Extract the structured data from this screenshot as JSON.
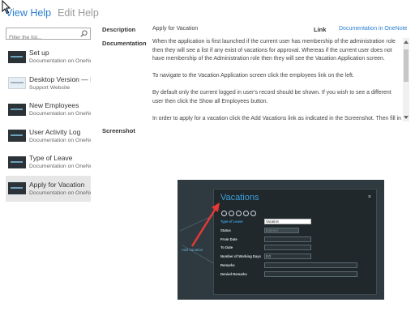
{
  "tabs": {
    "view_help": "View Help",
    "edit_help": "Edit Help"
  },
  "search": {
    "placeholder": "Filter the list..."
  },
  "list": {
    "items": [
      {
        "title": "Set up",
        "subtitle": "Documentation on OneNote"
      },
      {
        "title": "Desktop Version — Page",
        "subtitle": "Support Website"
      },
      {
        "title": "New Employees",
        "subtitle": "Documentation on OneNote"
      },
      {
        "title": "User Activity Log",
        "subtitle": "Documentation on OneNote"
      },
      {
        "title": "Type of Leave",
        "subtitle": "Documentation on OneNote"
      },
      {
        "title": "Apply for Vacation",
        "subtitle": "Documentation on OneNote"
      }
    ],
    "selected_index": 5
  },
  "detail": {
    "description_label": "Description",
    "description_value": "Apply for Vacation",
    "link_label": "Link",
    "link_value": "Documentation in OneNote",
    "documentation_label": "Documentation",
    "documentation_paragraphs": [
      "When the application is first launched if the current user has membership of the administration role then they will see a list if any exist of vacations for approval.  Whereas if the current user does not have membership of the Administration role then they will see the Vacation Application screen.",
      "To navigate to the Vacation Application screen click the employees link on the left.",
      "By default only the current logged in user's record should be shown.  If you wish to see a different user then click the Show all Employees button.",
      "In order to apply for a vacation click the Add Vacations link as indicated in the Screenshot.  Then fill in"
    ],
    "screenshot_label": "Screenshot"
  },
  "screenshot": {
    "side_link": "Add Vacation",
    "dialog_title": "Vacations",
    "close": "×",
    "fields": [
      {
        "label": "Type of Leave",
        "value": "Vacation"
      },
      {
        "label": "Status",
        "value": "Entered"
      },
      {
        "label": "From Date",
        "value": ""
      },
      {
        "label": "To Date",
        "value": ""
      },
      {
        "label": "Number of Working Days",
        "value": "0.0"
      },
      {
        "label": "Remarks",
        "value": ""
      },
      {
        "label": "Denied Remarks",
        "value": ""
      }
    ]
  },
  "colors": {
    "accent": "#2a7fd1",
    "dialog_bg": "#20282c",
    "arrow": "#e53935"
  }
}
